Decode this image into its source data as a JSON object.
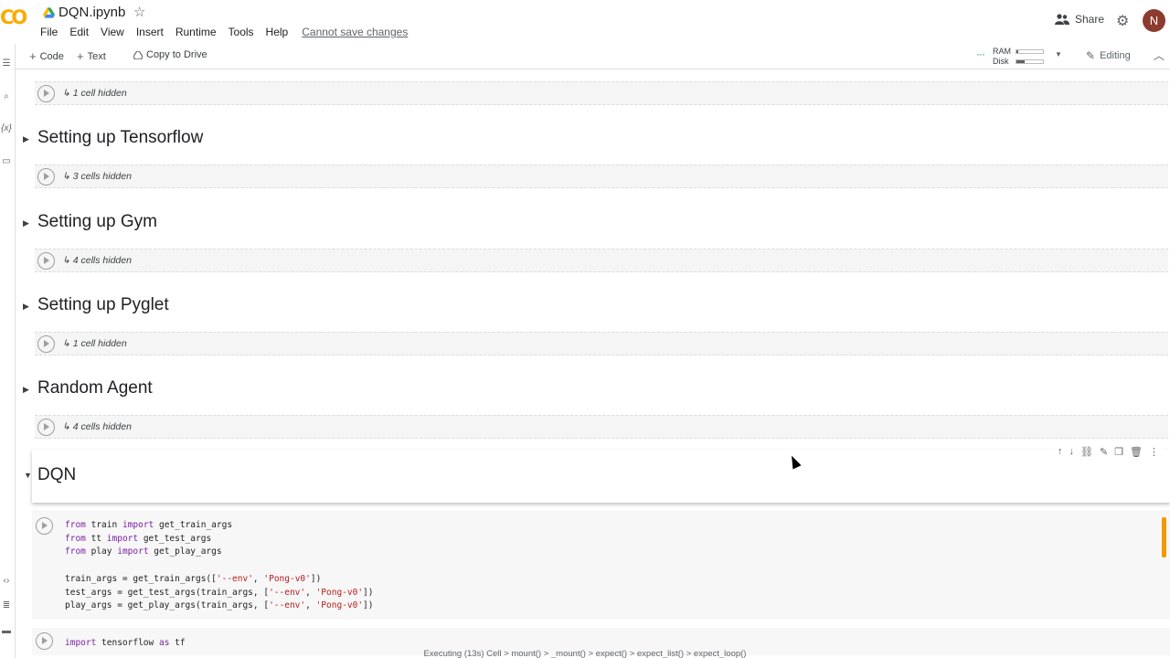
{
  "app": {
    "title": "DQN.ipynb",
    "logo_text": "CO",
    "avatar_initial": "N"
  },
  "menu": [
    "File",
    "Edit",
    "View",
    "Insert",
    "Runtime",
    "Tools",
    "Help"
  ],
  "menu_notice": "Cannot save changes",
  "header": {
    "share_label": "Share"
  },
  "toolbar": {
    "code_label": "Code",
    "text_label": "Text",
    "copy_label": "Copy to Drive",
    "ram_label": "RAM",
    "disk_label": "Disk",
    "ram_usage": 0.08,
    "disk_usage": 0.3,
    "editing_label": "Editing"
  },
  "hidden_cells": [
    {
      "label": "1 cell hidden"
    },
    {
      "label": "3 cells hidden"
    },
    {
      "label": "4 cells hidden"
    },
    {
      "label": "1 cell hidden"
    },
    {
      "label": "4 cells hidden"
    }
  ],
  "sections": [
    {
      "title": "Setting up Tensorflow"
    },
    {
      "title": "Setting up Gym"
    },
    {
      "title": "Setting up Pyglet"
    },
    {
      "title": "Random Agent"
    }
  ],
  "dqn": {
    "title": "DQN"
  },
  "code1": {
    "lines": [
      [
        {
          "t": "from",
          "c": "kw"
        },
        {
          "t": " train "
        },
        {
          "t": "import",
          "c": "kw"
        },
        {
          "t": " get_train_args"
        }
      ],
      [
        {
          "t": "from",
          "c": "kw"
        },
        {
          "t": " tt "
        },
        {
          "t": "import",
          "c": "kw"
        },
        {
          "t": " get_test_args"
        }
      ],
      [
        {
          "t": "from",
          "c": "kw"
        },
        {
          "t": " play "
        },
        {
          "t": "import",
          "c": "kw"
        },
        {
          "t": " get_play_args"
        }
      ],
      [
        {
          "t": ""
        }
      ],
      [
        {
          "t": "train_args = get_train_args(["
        },
        {
          "t": "'--env'",
          "c": "str"
        },
        {
          "t": ", "
        },
        {
          "t": "'Pong-v0'",
          "c": "str"
        },
        {
          "t": "])"
        }
      ],
      [
        {
          "t": "test_args = get_test_args(train_args, ["
        },
        {
          "t": "'--env'",
          "c": "str"
        },
        {
          "t": ", "
        },
        {
          "t": "'Pong-v0'",
          "c": "str"
        },
        {
          "t": "])"
        }
      ],
      [
        {
          "t": "play_args = get_play_args(train_args, ["
        },
        {
          "t": "'--env'",
          "c": "str"
        },
        {
          "t": ", "
        },
        {
          "t": "'Pong-v0'",
          "c": "str"
        },
        {
          "t": "])"
        }
      ]
    ]
  },
  "code2": {
    "lines": [
      [
        {
          "t": "import",
          "c": "kw"
        },
        {
          "t": " tensorflow "
        },
        {
          "t": "as",
          "c": "kw"
        },
        {
          "t": " tf"
        }
      ]
    ]
  },
  "status": "Executing (13s)  Cell > mount() > _mount() > expect() > expect_list() > expect_loop()"
}
